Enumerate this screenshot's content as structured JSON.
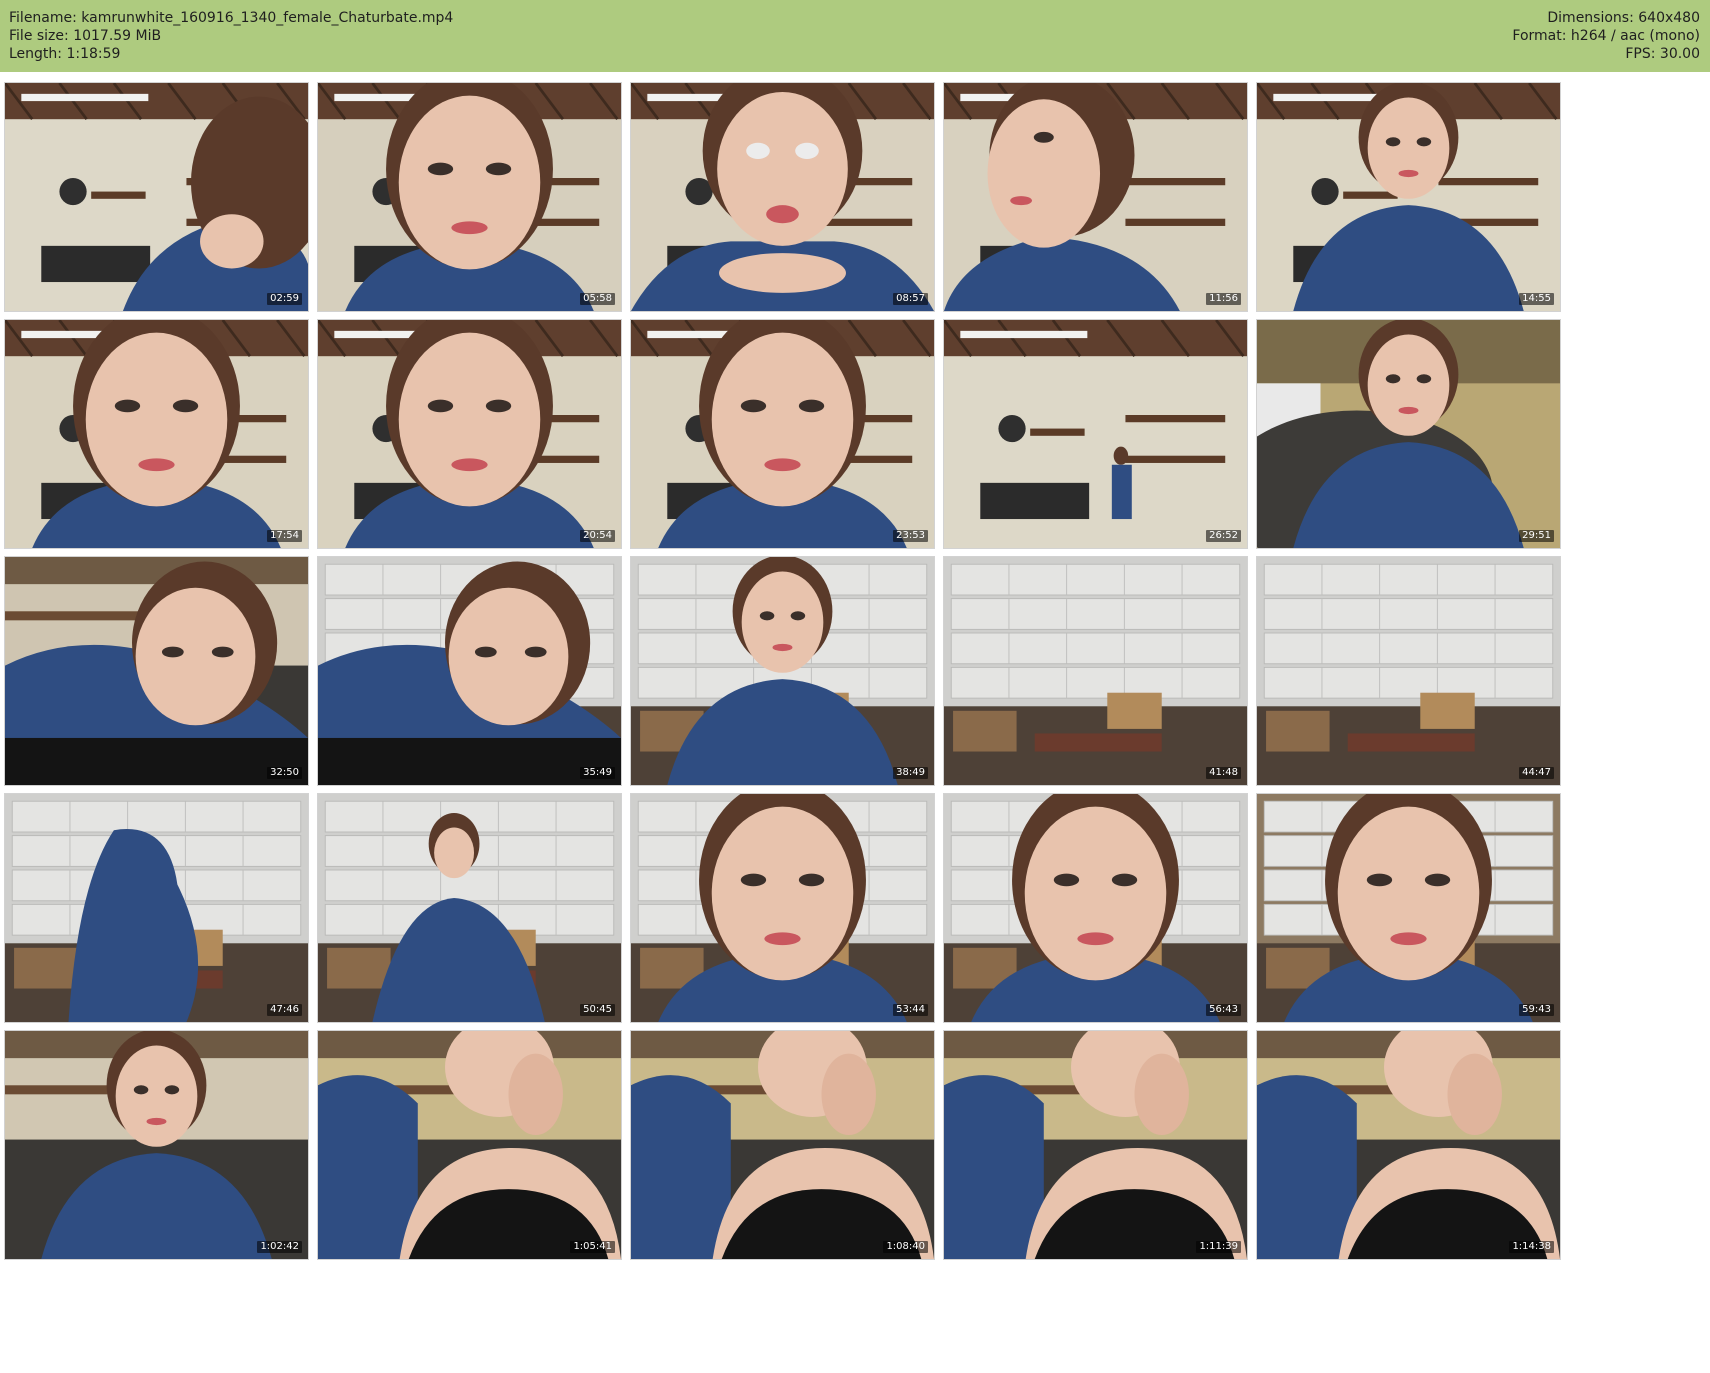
{
  "header": {
    "filename": "Filename: kamrunwhite_160916_1340_female_Chaturbate.mp4",
    "file_size": "File size: 1017.59 MiB",
    "length": "Length: 1:18:59",
    "dimensions": "Dimensions: 640x480",
    "format": "Format: h264 / aac (mono)",
    "fps": "FPS: 30.00"
  },
  "colors": {
    "header_bg": "#aecb7f",
    "frame_border": "#d2d2d2"
  },
  "thumbnails": [
    {
      "timestamp": "02:59",
      "scene": "garage-wall",
      "subject": "head-turned-away",
      "top_color": "#5f3f2e",
      "wall_color": "#ddd8c8"
    },
    {
      "timestamp": "05:58",
      "scene": "garage-wall",
      "subject": "face-closeup",
      "top_color": "#5f3f2e",
      "wall_color": "#d6cfbd"
    },
    {
      "timestamp": "08:57",
      "scene": "garage-wall",
      "subject": "face-closeup-hands",
      "top_color": "#5f3f2e",
      "wall_color": "#d9d1bf"
    },
    {
      "timestamp": "11:56",
      "scene": "garage-wall",
      "subject": "face-profile",
      "top_color": "#5f3f2e",
      "wall_color": "#d8d1bf"
    },
    {
      "timestamp": "14:55",
      "scene": "garage-wall",
      "subject": "upper-body",
      "top_color": "#5f3f2e",
      "wall_color": "#dcd6c4"
    },
    {
      "timestamp": "17:54",
      "scene": "garage-wall",
      "subject": "face-closeup",
      "top_color": "#5f3f2e",
      "wall_color": "#d9d2bf"
    },
    {
      "timestamp": "20:54",
      "scene": "garage-wall",
      "subject": "face-closeup",
      "top_color": "#5f3f2e",
      "wall_color": "#d9d2bf"
    },
    {
      "timestamp": "23:53",
      "scene": "garage-wall",
      "subject": "face-closeup",
      "top_color": "#5f3f2e",
      "wall_color": "#d9d2bf"
    },
    {
      "timestamp": "26:52",
      "scene": "garage-wall",
      "subject": "standing-far",
      "top_color": "#5f3f2e",
      "wall_color": "#ddd8c8"
    },
    {
      "timestamp": "29:51",
      "scene": "couch-room",
      "subject": "upper-body",
      "top_color": "#7a6b4a",
      "wall_color": "#b9a774"
    },
    {
      "timestamp": "32:50",
      "scene": "shelf-room",
      "subject": "leaning-in",
      "top_color": "#6e5a44",
      "wall_color": "#cfc5b1"
    },
    {
      "timestamp": "35:49",
      "scene": "garage-door",
      "subject": "leaning-in",
      "top_color": "#d7d7d5",
      "wall_color": "#cfcfcd"
    },
    {
      "timestamp": "38:49",
      "scene": "garage-door",
      "subject": "upper-body",
      "top_color": "#d7d7d5",
      "wall_color": "#cfcfcd"
    },
    {
      "timestamp": "41:48",
      "scene": "garage-door",
      "subject": "empty",
      "top_color": "#d7d7d5",
      "wall_color": "#cfcfcd"
    },
    {
      "timestamp": "44:47",
      "scene": "garage-door",
      "subject": "empty",
      "top_color": "#d7d7d5",
      "wall_color": "#cfcfcd"
    },
    {
      "timestamp": "47:46",
      "scene": "garage-door",
      "subject": "dressing",
      "top_color": "#d7d7d5",
      "wall_color": "#cfcfcd"
    },
    {
      "timestamp": "50:45",
      "scene": "garage-door",
      "subject": "standing",
      "top_color": "#d7d7d5",
      "wall_color": "#cfcfcd"
    },
    {
      "timestamp": "53:44",
      "scene": "garage-door",
      "subject": "face-closeup",
      "top_color": "#d7d7d5",
      "wall_color": "#cfcfcd"
    },
    {
      "timestamp": "56:43",
      "scene": "garage-door",
      "subject": "face-closeup",
      "top_color": "#d7d7d5",
      "wall_color": "#cfcfcd"
    },
    {
      "timestamp": "59:43",
      "scene": "garage-door",
      "subject": "face-closeup",
      "top_color": "#7a5a44",
      "wall_color": "#8d7a62"
    },
    {
      "timestamp": "1:02:42",
      "scene": "shelf-room",
      "subject": "upper-body",
      "top_color": "#6e5a44",
      "wall_color": "#d1c7b2"
    },
    {
      "timestamp": "1:05:41",
      "scene": "shelf-room",
      "subject": "hand-on-face",
      "top_color": "#6e5a44",
      "wall_color": "#c9b98a"
    },
    {
      "timestamp": "1:08:40",
      "scene": "shelf-room",
      "subject": "hand-on-face",
      "top_color": "#6e5a44",
      "wall_color": "#c9b98a"
    },
    {
      "timestamp": "1:11:39",
      "scene": "shelf-room",
      "subject": "hand-on-face",
      "top_color": "#6e5a44",
      "wall_color": "#c9b98a"
    },
    {
      "timestamp": "1:14:38",
      "scene": "shelf-room",
      "subject": "hand-on-face",
      "top_color": "#6e5a44",
      "wall_color": "#c9b98a"
    }
  ]
}
